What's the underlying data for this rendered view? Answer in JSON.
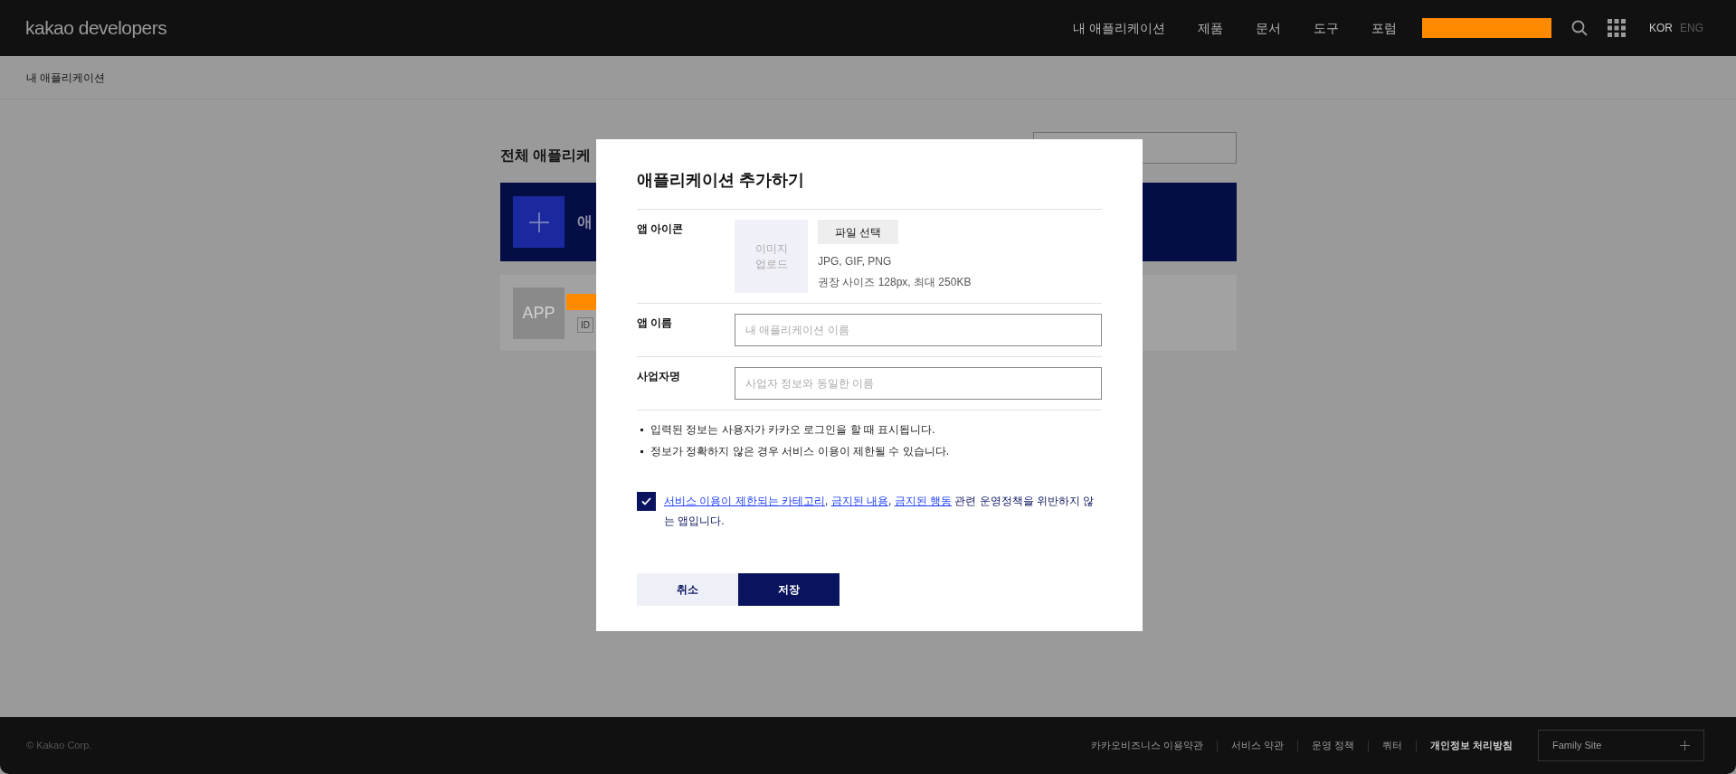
{
  "header": {
    "logo": "kakao developers",
    "nav": [
      "내 애플리케이션",
      "제품",
      "문서",
      "도구",
      "포럼"
    ],
    "languages": [
      {
        "label": "KOR",
        "selected": true
      },
      {
        "label": "ENG",
        "selected": false
      }
    ]
  },
  "breadcrumb": "내 애플리케이션",
  "background": {
    "title": "전체 애플리케",
    "banner_text": "애",
    "app_card": {
      "icon_text": "APP",
      "tag": "ID"
    }
  },
  "modal": {
    "title": "애플리케이션 추가하기",
    "rows": [
      {
        "kind": "icon",
        "label": "앱 아이콘",
        "upload_lines": [
          "이미지",
          "업로드"
        ],
        "button": "파일 선택",
        "hints": [
          "JPG, GIF, PNG",
          "권장 사이즈 128px, 최대 250KB"
        ]
      },
      {
        "kind": "input",
        "label": "앱 이름",
        "placeholder": "내 애플리케이션 이름"
      },
      {
        "kind": "input",
        "label": "사업자명",
        "placeholder": "사업자 정보와 동일한 이름"
      }
    ],
    "notes": [
      "입력된 정보는 사용자가 카카오 로그인을 할 때 표시됩니다.",
      "정보가 정확하지 않은 경우 서비스 이용이 제한될 수 있습니다."
    ],
    "agreement": {
      "checked": true,
      "parts": [
        {
          "kind": "link",
          "text": "서비스 이용이 제한되는 카테고리"
        },
        {
          "kind": "text",
          "text": ", "
        },
        {
          "kind": "link",
          "text": "금지된 내용"
        },
        {
          "kind": "text",
          "text": ", "
        },
        {
          "kind": "link",
          "text": "금지된 행동"
        },
        {
          "kind": "text",
          "text": " 관련 운영정책을 위반하지 않는 앱입니다."
        }
      ]
    },
    "buttons": [
      {
        "kind": "secondary",
        "label": "취소"
      },
      {
        "kind": "primary",
        "label": "저장"
      }
    ]
  },
  "footer": {
    "copyright": "© Kakao Corp.",
    "links": [
      {
        "label": "카카오비즈니스 이용약관",
        "bold": false
      },
      {
        "label": "서비스 약관",
        "bold": false
      },
      {
        "label": "운영 정책",
        "bold": false
      },
      {
        "label": "쿼터",
        "bold": false
      },
      {
        "label": "개인정보 처리방침",
        "bold": true
      }
    ],
    "family_site": "Family Site"
  }
}
